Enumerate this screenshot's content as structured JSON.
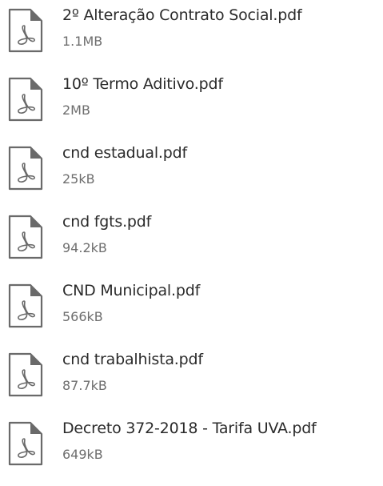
{
  "files": [
    {
      "name": "2º Alteração Contrato Social.pdf",
      "size": "1.1MB",
      "icon": "pdf-file-icon"
    },
    {
      "name": "10º Termo Aditivo.pdf",
      "size": "2MB",
      "icon": "pdf-file-icon"
    },
    {
      "name": "cnd estadual.pdf",
      "size": "25kB",
      "icon": "pdf-file-icon"
    },
    {
      "name": "cnd fgts.pdf",
      "size": "94.2kB",
      "icon": "pdf-file-icon"
    },
    {
      "name": "CND Municipal.pdf",
      "size": "566kB",
      "icon": "pdf-file-icon"
    },
    {
      "name": "cnd trabalhista.pdf",
      "size": "87.7kB",
      "icon": "pdf-file-icon"
    },
    {
      "name": "Decreto 372-2018 - Tarifa UVA.pdf",
      "size": "649kB",
      "icon": "pdf-file-icon"
    }
  ],
  "colors": {
    "text": "#2b2b2b",
    "subtext": "#6e6e6e",
    "icon_stroke": "#6a6a6a"
  }
}
